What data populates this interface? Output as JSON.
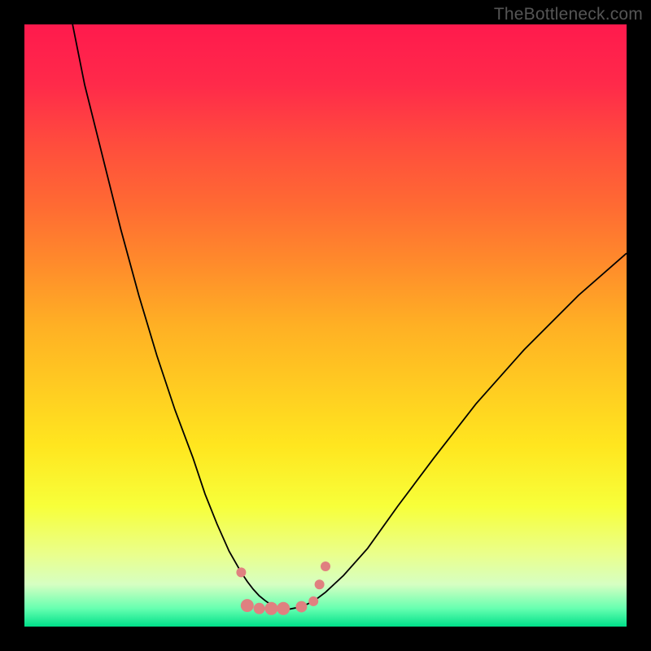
{
  "watermark": "TheBottleneck.com",
  "colors": {
    "curve": "#000000",
    "markers": "#e08080",
    "frame_bg": "#000000"
  },
  "chart_data": {
    "type": "line",
    "title": "",
    "xlabel": "",
    "ylabel": "",
    "xlim": [
      0,
      100
    ],
    "ylim": [
      0,
      100
    ],
    "curve": {
      "name": "bottleneck-curve",
      "x": [
        8,
        10,
        13,
        16,
        19,
        22,
        25,
        28,
        30,
        32,
        34,
        36,
        37,
        38,
        39,
        40,
        41,
        42,
        43,
        44,
        46,
        48,
        50,
        53,
        57,
        62,
        68,
        75,
        83,
        92,
        100
      ],
      "y": [
        100,
        90,
        78,
        66,
        55,
        45,
        36,
        28,
        22,
        17,
        12.5,
        9,
        7.5,
        6.2,
        5.1,
        4.3,
        3.6,
        3.1,
        2.9,
        2.9,
        3.3,
        4.2,
        5.7,
        8.5,
        13,
        20,
        28,
        37,
        46,
        55,
        62
      ]
    },
    "markers": [
      {
        "x": 36,
        "y": 9,
        "r": 6
      },
      {
        "x": 37,
        "y": 3.5,
        "r": 8
      },
      {
        "x": 39,
        "y": 3,
        "r": 7
      },
      {
        "x": 41,
        "y": 3,
        "r": 8
      },
      {
        "x": 43,
        "y": 3,
        "r": 8
      },
      {
        "x": 46,
        "y": 3.3,
        "r": 7
      },
      {
        "x": 48,
        "y": 4.2,
        "r": 6
      },
      {
        "x": 49,
        "y": 7,
        "r": 6
      },
      {
        "x": 50,
        "y": 10,
        "r": 6
      }
    ]
  }
}
